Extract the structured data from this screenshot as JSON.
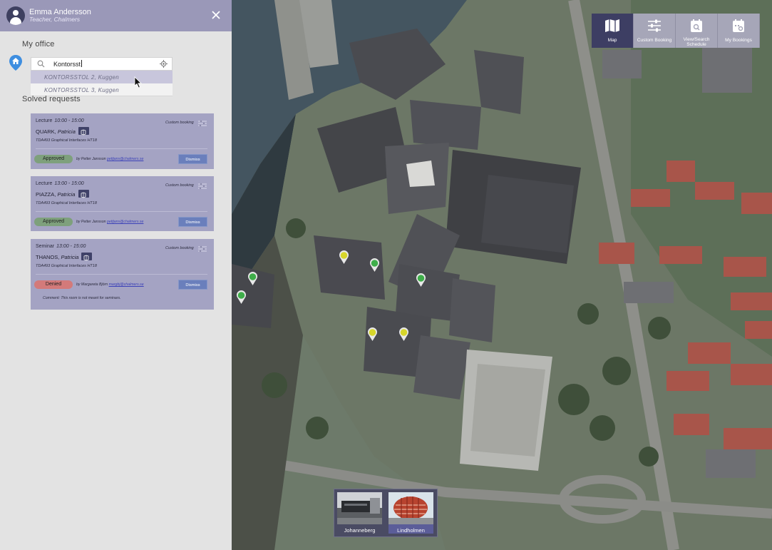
{
  "user": {
    "name": "Emma Andersson",
    "role": "Teacher, Chalmers"
  },
  "my_office": {
    "title": "My office",
    "search_value": "Kontorsst",
    "suggestions": [
      "KONTORSSTOL 2, Kuggen",
      "KONTORSSTOL 3, Kuggen"
    ]
  },
  "solved_requests": {
    "title": "Solved requests",
    "items": [
      {
        "type": "Lecture",
        "time": "10:00 - 15:00",
        "name_last": "QUARK,",
        "name_first": "Patricia",
        "course": "TDA493 Graphical Interfaces HT18",
        "booking_type": "Custom booking",
        "status": "Approved",
        "by_text": "by Petter Jansson",
        "email": "pettjans@chalmers.se",
        "dismiss": "Dismiss",
        "comment": ""
      },
      {
        "type": "Lecture",
        "time": "13:00 - 15:00",
        "name_last": "PIAZZA,",
        "name_first": "Patricia",
        "course": "TDA493 Graphical Interfaces HT18",
        "booking_type": "Custom booking",
        "status": "Approved",
        "by_text": "by Petter Jansson",
        "email": "pettjans@chalmers.se",
        "dismiss": "Dismiss",
        "comment": ""
      },
      {
        "type": "Seminar",
        "time": "13:00 - 15:00",
        "name_last": "THANOS,",
        "name_first": "Patricia",
        "course": "TDA493 Graphical Interfaces HT18",
        "booking_type": "Custom booking",
        "status": "Denied",
        "by_text": "by Margareta Björn",
        "email": "margbj@chalmers.se",
        "dismiss": "Dismiss",
        "comment": "Comment: This room is not meant for seminars."
      }
    ]
  },
  "nav": [
    {
      "label": "Map",
      "icon": "map-icon",
      "active": true
    },
    {
      "label": "Custom Booking",
      "icon": "sliders-icon",
      "active": false
    },
    {
      "label": "View/Search Schedule",
      "icon": "calendar-search-icon",
      "active": false
    },
    {
      "label": "My Bookings",
      "icon": "calendar-settings-icon",
      "active": false
    }
  ],
  "campuses": [
    {
      "label": "Johanneberg",
      "selected": false
    },
    {
      "label": "Lindholmen",
      "selected": true
    }
  ],
  "colors": {
    "header": "#9a98b8",
    "card": "#a4a3c3",
    "nav_active": "#3d3e63",
    "approved": "#7ea07c",
    "denied": "#d37a7a",
    "pin_green": "#3fae4a",
    "pin_yellow": "#d7d62a"
  }
}
